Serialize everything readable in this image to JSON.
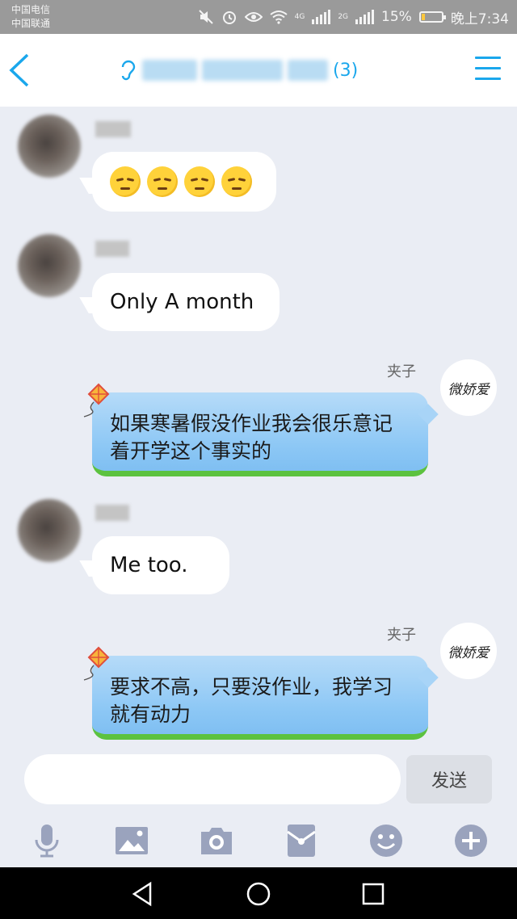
{
  "status_bar": {
    "carrier_1": "中国电信",
    "carrier_2": "中国联通",
    "signal_1_label": "4G",
    "signal_2_label": "2G",
    "battery": "15%",
    "time": "晚上7:34",
    "battery_level": 0.15
  },
  "header": {
    "member_count": "(3)",
    "accent_color": "#1aa7ec"
  },
  "messages": [
    {
      "direction": "incoming",
      "sender": "",
      "content": "😔😔😔😔",
      "emoji_count": 4
    },
    {
      "direction": "incoming",
      "sender": "",
      "content": "Only A month"
    },
    {
      "direction": "outgoing",
      "sender": "夹子",
      "content": "如果寒暑假没作业我会很乐意记着开学这个事实的"
    },
    {
      "direction": "incoming",
      "sender": "",
      "content": "Me too."
    },
    {
      "direction": "outgoing",
      "sender": "夹子",
      "content": "要求不高，只要没作业，我学习就有动力"
    }
  ],
  "self_avatar_text": "微娇爱",
  "input": {
    "value": "",
    "placeholder": "",
    "send_label": "发送"
  },
  "toolbar_icons": [
    "microphone-icon",
    "image-icon",
    "camera-icon",
    "red-packet-icon",
    "emoji-icon",
    "plus-icon"
  ],
  "nav_icons": [
    "back-triangle-icon",
    "home-circle-icon",
    "recents-square-icon"
  ]
}
